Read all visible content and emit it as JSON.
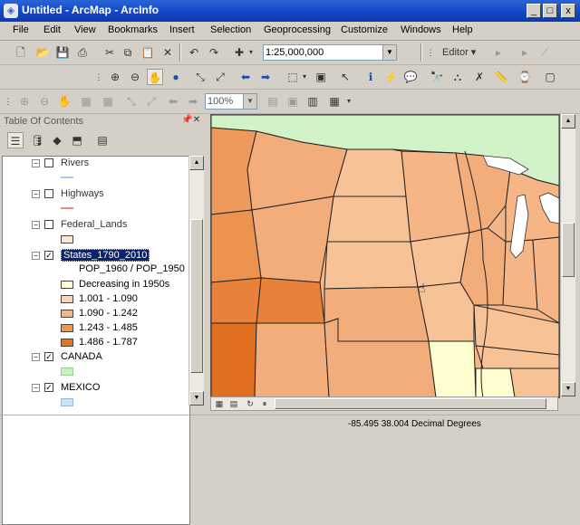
{
  "window": {
    "title": "Untitled - ArcMap - ArcInfo",
    "controls": [
      "_",
      "□",
      "x"
    ]
  },
  "menu": [
    "File",
    "Edit",
    "View",
    "Bookmarks",
    "Insert",
    "Selection",
    "Geoprocessing",
    "Customize",
    "Windows",
    "Help"
  ],
  "standard_toolbar": {
    "scale": "1:25,000,000",
    "editor_label": "Editor ▾"
  },
  "layout_toolbar": {
    "zoom_percent": "100%"
  },
  "toc": {
    "title": "Table Of Contents",
    "layers": [
      {
        "name": "Rivers",
        "checked": false
      },
      {
        "name": "Highways",
        "checked": false
      },
      {
        "name": "Federal_Lands",
        "checked": false
      },
      {
        "name": "States_1790_2010",
        "checked": true,
        "selected": true,
        "field": "POP_1960 / POP_1950",
        "classes": [
          {
            "label": "Decreasing in 1950s",
            "color": "#ffffd0"
          },
          {
            "label": "1.001 - 1.090",
            "color": "#fbd7b4"
          },
          {
            "label": "1.090 - 1.242",
            "color": "#f5b585"
          },
          {
            "label": "1.243 - 1.485",
            "color": "#ef9750"
          },
          {
            "label": "1.486 - 1.787",
            "color": "#e4761e"
          }
        ]
      },
      {
        "name": "CANADA",
        "checked": true,
        "color": "#c8f0c0"
      },
      {
        "name": "MEXICO",
        "checked": true,
        "color": "#c8e4f8"
      }
    ]
  },
  "status": {
    "coordinates": "-85.495  38.004 Decimal Degrees"
  },
  "colors": {
    "canada": "#d2f2c8",
    "lake": "#ffffff",
    "border": "#222222"
  }
}
